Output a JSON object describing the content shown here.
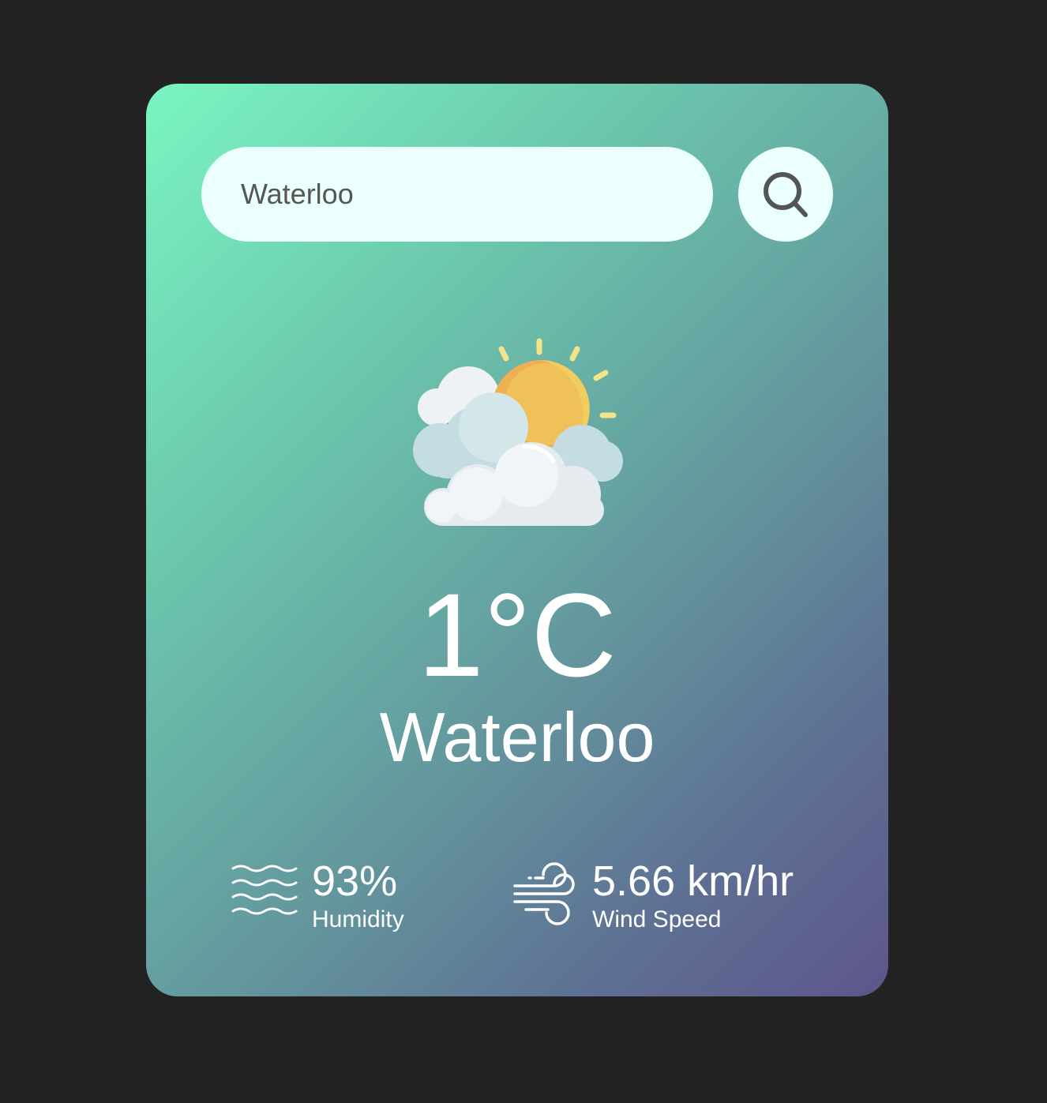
{
  "search": {
    "value": "Waterloo",
    "placeholder": "",
    "button_icon": "search-icon"
  },
  "weather": {
    "icon": "partly-cloudy-icon",
    "temperature": "1°C",
    "city": "Waterloo"
  },
  "stats": {
    "humidity": {
      "icon": "humidity-waves-icon",
      "value": "93%",
      "label": "Humidity"
    },
    "wind": {
      "icon": "wind-icon",
      "value": "5.66 km/hr",
      "label": "Wind Speed"
    }
  },
  "colors": {
    "background": "#222222",
    "card_gradient_start": "#7af5c2",
    "card_gradient_end": "#5d568a",
    "input_background": "#ebfffc",
    "text": "#ffffff"
  }
}
